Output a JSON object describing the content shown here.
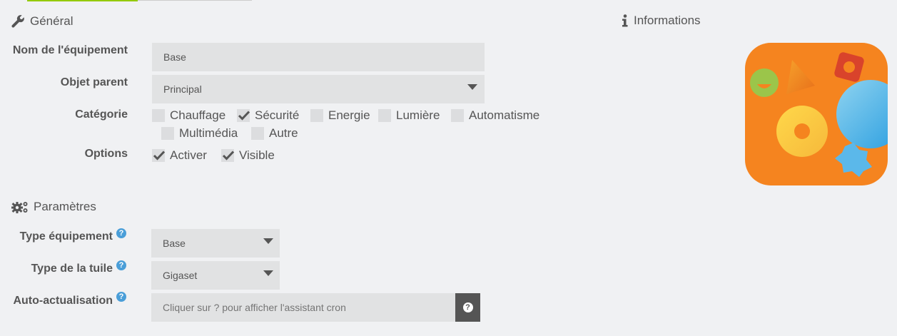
{
  "general": {
    "title": "Général",
    "name_label": "Nom de l'équipement",
    "name_value": "Base",
    "parent_label": "Objet parent",
    "parent_value": "Principal",
    "category_label": "Catégorie",
    "categories": [
      {
        "label": "Chauffage",
        "checked": false
      },
      {
        "label": "Sécurité",
        "checked": true
      },
      {
        "label": "Energie",
        "checked": false
      },
      {
        "label": "Lumière",
        "checked": false
      },
      {
        "label": "Automatisme",
        "checked": false
      },
      {
        "label": "Multimédia",
        "checked": false
      },
      {
        "label": "Autre",
        "checked": false
      }
    ],
    "options_label": "Options",
    "options": [
      {
        "label": "Activer",
        "checked": true
      },
      {
        "label": "Visible",
        "checked": true
      }
    ]
  },
  "info": {
    "title": "Informations"
  },
  "params": {
    "title": "Paramètres",
    "type_label": "Type équipement",
    "type_value": "Base",
    "tile_label": "Type de la tuile",
    "tile_value": "Gigaset",
    "refresh_label": "Auto-actualisation",
    "refresh_placeholder": "Cliquer sur ? pour afficher l'assistant cron",
    "help_glyph": "?"
  },
  "colors": {
    "accent": "#94ca02",
    "help": "#4a9ed8",
    "logo_bg": "#f5841f"
  },
  "icons": {
    "general": "wrench-icon",
    "info": "info-icon",
    "params": "cogs-icon",
    "help": "question-circle-icon"
  }
}
